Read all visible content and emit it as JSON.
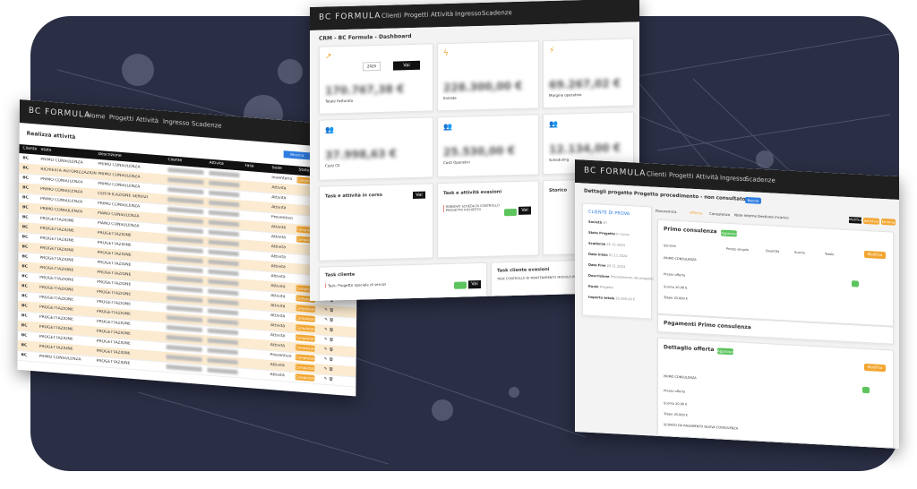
{
  "brand": "BC FORMULA",
  "nav": {
    "home": "Home",
    "clienti": "Clienti",
    "progetti": "Progetti",
    "attivita": "Attività",
    "ingresso": "Ingresso",
    "scadenze": "Scadenze"
  },
  "activity": {
    "title": "Realizza attività",
    "search_label": "Ricerca",
    "columns": [
      "Cliente",
      "Stato",
      "Descrizione",
      "Cliente",
      "Attività",
      "Fase",
      "Sede",
      "Stato"
    ],
    "rows": [
      {
        "code": "BC",
        "name": "PRIMO CONSULENZA",
        "desc": "PRIMO CONSULENZA",
        "fase": "Inventario",
        "stato": "Completato"
      },
      {
        "code": "BC",
        "name": "RICHIESTA AUTORIZZAZIONE",
        "desc": "PRIMO CONSULENZA",
        "fase": "Attività",
        "stato": ""
      },
      {
        "code": "BC",
        "name": "PRIMO CONSULENZA",
        "desc": "PRIMO CONSULENZA",
        "fase": "Attività",
        "stato": ""
      },
      {
        "code": "BC",
        "name": "PRIMO CONSULENZA",
        "desc": "CERTIFICAZIONE SERVIZI",
        "fase": "Attività",
        "stato": ""
      },
      {
        "code": "BC",
        "name": "PRIMO CONSULENZA",
        "desc": "PRIMO CONSULENZA",
        "fase": "Preventivo",
        "stato": ""
      },
      {
        "code": "BC",
        "name": "PRIMO CONSULENZA",
        "desc": "PIANO CONSULENZA",
        "fase": "Attività",
        "stato": "Completato"
      },
      {
        "code": "BC",
        "name": "PROGETTAZIONE",
        "desc": "PIANO CONSULENZA",
        "fase": "Attività",
        "stato": "Completato"
      },
      {
        "code": "BC",
        "name": "PROGETTAZIONE",
        "desc": "PROGETTAZIONE",
        "fase": "Attività",
        "stato": ""
      },
      {
        "code": "BC",
        "name": "PROGETTAZIONE",
        "desc": "PROGETTAZIONE",
        "fase": "Attività",
        "stato": ""
      },
      {
        "code": "BC",
        "name": "PROGETTAZIONE",
        "desc": "PROGETTAZIONE",
        "fase": "Attività",
        "stato": ""
      },
      {
        "code": "BC",
        "name": "PROGETTAZIONE",
        "desc": "PROGETTAZIONE",
        "fase": "Attività",
        "stato": ""
      },
      {
        "code": "BC",
        "name": "PROGETTAZIONE",
        "desc": "PROGETTAZIONE",
        "fase": "Attività",
        "stato": "Completato"
      },
      {
        "code": "BC",
        "name": "PROGETTAZIONE",
        "desc": "PROGETTAZIONE",
        "fase": "Attività",
        "stato": "Completato"
      },
      {
        "code": "BC",
        "name": "PROGETTAZIONE",
        "desc": "PROGETTAZIONE",
        "fase": "Attività",
        "stato": "Completato"
      },
      {
        "code": "BC",
        "name": "PROGETTAZIONE",
        "desc": "PROGETTAZIONE",
        "fase": "Attività",
        "stato": "Completato"
      },
      {
        "code": "BC",
        "name": "PROGETTAZIONE",
        "desc": "PROGETTAZIONE",
        "fase": "Attività",
        "stato": "Completato"
      },
      {
        "code": "BC",
        "name": "PROGETTAZIONE",
        "desc": "PROGETTAZIONE",
        "fase": "Attività",
        "stato": "Completato"
      },
      {
        "code": "BC",
        "name": "PROGETTAZIONE",
        "desc": "PROGETTAZIONE",
        "fase": "Attività",
        "stato": "Completato"
      },
      {
        "code": "BC",
        "name": "PROGETTAZIONE",
        "desc": "PROGETTAZIONE",
        "fase": "Preventivo",
        "stato": "Completato"
      },
      {
        "code": "BC",
        "name": "PROGETTAZIONE",
        "desc": "PROGETTAZIONE",
        "fase": "Attività",
        "stato": "Completato"
      },
      {
        "code": "BC",
        "name": "PRIMO CONSULENZA",
        "desc": "PROGETTAZIONE",
        "fase": "Attività",
        "stato": "Completato"
      }
    ]
  },
  "dashboard": {
    "title": "CRM - BC Formula - Dashboard",
    "year": "2025",
    "filter_btn": "Vai",
    "cards": [
      {
        "value": "170.767,38 €",
        "label": "Totale Fatturato"
      },
      {
        "value": "228.300,00 €",
        "label": "Entrate"
      },
      {
        "value": "69.267,02 €",
        "label": "Margine operativo"
      },
      {
        "value": "37.998,63 €",
        "label": "Costi CE"
      },
      {
        "value": "25.530,00 €",
        "label": "Costi Operativi"
      },
      {
        "value": "12.134,00 €",
        "label": "Scheduling"
      }
    ],
    "task_title": "Task e attività in corso",
    "task_btn": "Vai",
    "task2_title": "Task e attività evasioni",
    "task2_item": "RINNOVO SCHEDA DI CONTROLLO PROGETTO RICHIESTO",
    "task2_btn": "Vai",
    "notes_title": "Storico",
    "bottom1_title": "Task cliente",
    "bottom1_item": "Task: Progetto speciale di servizi",
    "bottom1_btn": "Vai",
    "bottom2_title": "Task cliente evasioni",
    "bottom2_item": "TASK CONTROLLO DI MANTENIMENTO MODULO PROGETTO"
  },
  "detail": {
    "title": "Dettagli progetto Progetto procedimento - non consultato",
    "badge": "Nuovo",
    "tabs": [
      "Panoramica",
      "Offerta",
      "Consulenza",
      "Note interne",
      "Gestione incarico"
    ],
    "top_btns": [
      "Modifica",
      "Archivia",
      "Elimina"
    ],
    "sidebar_title": "CLIENTE DI PROVA",
    "sidebar": [
      {
        "k": "Società",
        "v": "Srl"
      },
      {
        "k": "Stato Progetto",
        "v": "In Corso"
      },
      {
        "k": "Scadenza",
        "v": "26.12.2024"
      },
      {
        "k": "Data Inizio",
        "v": "01.11.2024"
      },
      {
        "k": "Data Fine",
        "v": "20.11.2024"
      },
      {
        "k": "Descrizione",
        "v": "Procedimento del progetto"
      },
      {
        "k": "Ruolo",
        "v": "Progetto"
      },
      {
        "k": "Importo totale",
        "v": "25.000,00 €"
      }
    ],
    "sec1_title": "Primo consulenza",
    "sec1_badge": "Approvato",
    "sec1_btn": "Modifica",
    "sec1_cols": [
      "Servizio",
      "Prezzo singolo",
      "Quantità",
      "Sconto",
      "Totale"
    ],
    "sec1_rows": [
      "PRIMO CONSULENZA",
      "Prezzo offerta",
      "Sconto 20,00 €",
      "Totale 20,000 €"
    ],
    "sec2_title": "Pagamenti Primo consulenza",
    "sec3_title": "Dettaglio offerta",
    "sec3_badge": "Approvato",
    "sec3_btn": "Modifica",
    "sec3_rows": [
      "PRIMO CONSULENZA",
      "Prezzo offerta",
      "Sconto 20,00 €",
      "Totale 20,000 €",
      "SCONTO DA PAGAMENTO NUOVA CONSULENZA"
    ]
  }
}
